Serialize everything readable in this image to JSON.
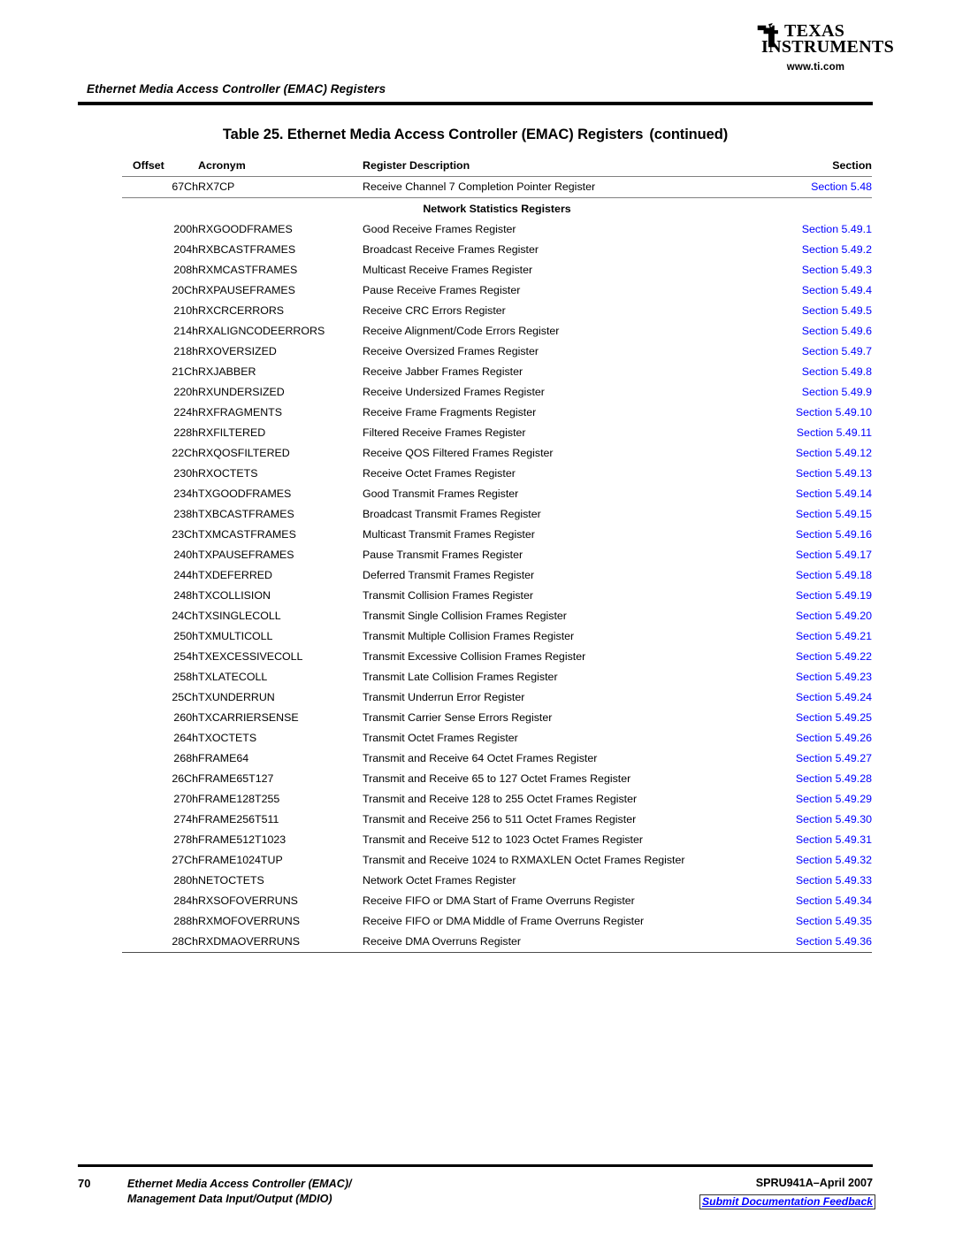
{
  "logo": {
    "icon": "ti-logo-icon",
    "word1": "TEXAS",
    "word2": "INSTRUMENTS",
    "url": "www.ti.com"
  },
  "header": {
    "running_title": "Ethernet Media Access Controller (EMAC) Registers"
  },
  "table": {
    "title": "Table 25. Ethernet Media Access Controller (EMAC) Registers",
    "title_continued": "(continued)",
    "columns": [
      "Offset",
      "Acronym",
      "Register Description",
      "Section"
    ],
    "first_row": {
      "offset": "67Ch",
      "acronym": "RX7CP",
      "description": "Receive Channel 7 Completion Pointer Register",
      "section": "Section 5.48"
    },
    "group_heading": "Network Statistics Registers",
    "rows": [
      {
        "offset": "200h",
        "acronym": "RXGOODFRAMES",
        "description": "Good Receive Frames Register",
        "section": "Section 5.49.1"
      },
      {
        "offset": "204h",
        "acronym": "RXBCASTFRAMES",
        "description": "Broadcast Receive Frames Register",
        "section": "Section 5.49.2"
      },
      {
        "offset": "208h",
        "acronym": "RXMCASTFRAMES",
        "description": "Multicast Receive Frames Register",
        "section": "Section 5.49.3"
      },
      {
        "offset": "20Ch",
        "acronym": "RXPAUSEFRAMES",
        "description": "Pause Receive Frames Register",
        "section": "Section 5.49.4"
      },
      {
        "offset": "210h",
        "acronym": "RXCRCERRORS",
        "description": "Receive CRC Errors Register",
        "section": "Section 5.49.5"
      },
      {
        "offset": "214h",
        "acronym": "RXALIGNCODEERRORS",
        "description": "Receive Alignment/Code Errors Register",
        "section": "Section 5.49.6"
      },
      {
        "offset": "218h",
        "acronym": "RXOVERSIZED",
        "description": "Receive Oversized Frames Register",
        "section": "Section 5.49.7"
      },
      {
        "offset": "21Ch",
        "acronym": "RXJABBER",
        "description": "Receive Jabber Frames Register",
        "section": "Section 5.49.8"
      },
      {
        "offset": "220h",
        "acronym": "RXUNDERSIZED",
        "description": "Receive Undersized Frames Register",
        "section": "Section 5.49.9"
      },
      {
        "offset": "224h",
        "acronym": "RXFRAGMENTS",
        "description": "Receive Frame Fragments Register",
        "section": "Section 5.49.10"
      },
      {
        "offset": "228h",
        "acronym": "RXFILTERED",
        "description": "Filtered Receive Frames Register",
        "section": "Section 5.49.11"
      },
      {
        "offset": "22Ch",
        "acronym": "RXQOSFILTERED",
        "description": "Receive QOS Filtered Frames Register",
        "section": "Section 5.49.12"
      },
      {
        "offset": "230h",
        "acronym": "RXOCTETS",
        "description": "Receive Octet Frames Register",
        "section": "Section 5.49.13"
      },
      {
        "offset": "234h",
        "acronym": "TXGOODFRAMES",
        "description": "Good Transmit Frames Register",
        "section": "Section 5.49.14"
      },
      {
        "offset": "238h",
        "acronym": "TXBCASTFRAMES",
        "description": "Broadcast Transmit Frames Register",
        "section": "Section 5.49.15"
      },
      {
        "offset": "23Ch",
        "acronym": "TXMCASTFRAMES",
        "description": "Multicast Transmit Frames Register",
        "section": "Section 5.49.16"
      },
      {
        "offset": "240h",
        "acronym": "TXPAUSEFRAMES",
        "description": "Pause Transmit Frames Register",
        "section": "Section 5.49.17"
      },
      {
        "offset": "244h",
        "acronym": "TXDEFERRED",
        "description": "Deferred Transmit Frames Register",
        "section": "Section 5.49.18"
      },
      {
        "offset": "248h",
        "acronym": "TXCOLLISION",
        "description": "Transmit Collision Frames Register",
        "section": "Section 5.49.19"
      },
      {
        "offset": "24Ch",
        "acronym": "TXSINGLECOLL",
        "description": "Transmit Single Collision Frames Register",
        "section": "Section 5.49.20"
      },
      {
        "offset": "250h",
        "acronym": "TXMULTICOLL",
        "description": "Transmit Multiple Collision Frames Register",
        "section": "Section 5.49.21"
      },
      {
        "offset": "254h",
        "acronym": "TXEXCESSIVECOLL",
        "description": "Transmit Excessive Collision Frames Register",
        "section": "Section 5.49.22"
      },
      {
        "offset": "258h",
        "acronym": "TXLATECOLL",
        "description": "Transmit Late Collision Frames Register",
        "section": "Section 5.49.23"
      },
      {
        "offset": "25Ch",
        "acronym": "TXUNDERRUN",
        "description": "Transmit Underrun Error Register",
        "section": "Section 5.49.24"
      },
      {
        "offset": "260h",
        "acronym": "TXCARRIERSENSE",
        "description": "Transmit Carrier Sense Errors Register",
        "section": "Section 5.49.25"
      },
      {
        "offset": "264h",
        "acronym": "TXOCTETS",
        "description": "Transmit Octet Frames Register",
        "section": "Section 5.49.26"
      },
      {
        "offset": "268h",
        "acronym": "FRAME64",
        "description": "Transmit and Receive 64 Octet Frames Register",
        "section": "Section 5.49.27"
      },
      {
        "offset": "26Ch",
        "acronym": "FRAME65T127",
        "description": "Transmit and Receive 65 to 127 Octet Frames Register",
        "section": "Section 5.49.28"
      },
      {
        "offset": "270h",
        "acronym": "FRAME128T255",
        "description": "Transmit and Receive 128 to 255 Octet Frames Register",
        "section": "Section 5.49.29"
      },
      {
        "offset": "274h",
        "acronym": "FRAME256T511",
        "description": "Transmit and Receive 256 to 511 Octet Frames Register",
        "section": "Section 5.49.30"
      },
      {
        "offset": "278h",
        "acronym": "FRAME512T1023",
        "description": "Transmit and Receive 512 to 1023 Octet Frames Register",
        "section": "Section 5.49.31"
      },
      {
        "offset": "27Ch",
        "acronym": "FRAME1024TUP",
        "description": "Transmit and Receive 1024 to RXMAXLEN Octet Frames Register",
        "section": "Section 5.49.32"
      },
      {
        "offset": "280h",
        "acronym": "NETOCTETS",
        "description": "Network Octet Frames Register",
        "section": "Section 5.49.33"
      },
      {
        "offset": "284h",
        "acronym": "RXSOFOVERRUNS",
        "description": "Receive FIFO or DMA Start of Frame Overruns Register",
        "section": "Section 5.49.34"
      },
      {
        "offset": "288h",
        "acronym": "RXMOFOVERRUNS",
        "description": "Receive FIFO or DMA Middle of Frame Overruns Register",
        "section": "Section 5.49.35"
      },
      {
        "offset": "28Ch",
        "acronym": "RXDMAOVERRUNS",
        "description": "Receive DMA Overruns Register",
        "section": "Section 5.49.36"
      }
    ]
  },
  "footer": {
    "page_number": "70",
    "doc_title_line1": "Ethernet Media Access Controller (EMAC)/",
    "doc_title_line2": "Management Data Input/Output (MDIO)",
    "doc_number": "SPRU941A–April 2007",
    "feedback_link": "Submit Documentation Feedback"
  },
  "colors": {
    "link_blue": "#0000ff",
    "rule_black": "#000000",
    "rule_gray": "#808080"
  }
}
